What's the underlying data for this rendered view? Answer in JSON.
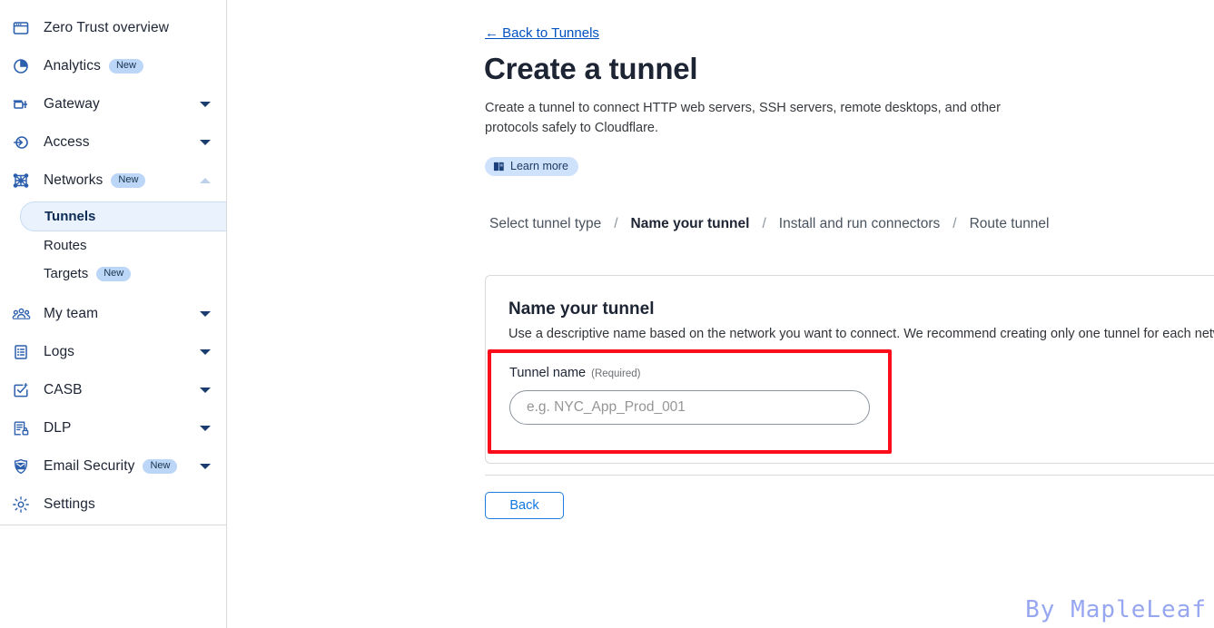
{
  "sidebar": {
    "items": [
      {
        "label": "Zero Trust overview",
        "icon": "window-overview-icon",
        "badge": null,
        "chevron": null
      },
      {
        "label": "Analytics",
        "icon": "pie-chart-icon",
        "badge": "New",
        "chevron": null
      },
      {
        "label": "Gateway",
        "icon": "gateway-arrow-icon",
        "badge": null,
        "chevron": "down"
      },
      {
        "label": "Access",
        "icon": "access-login-icon",
        "badge": null,
        "chevron": "down"
      },
      {
        "label": "Networks",
        "icon": "network-nodes-icon",
        "badge": "New",
        "chevron": "up"
      }
    ],
    "networks_subitems": [
      {
        "label": "Tunnels",
        "active": true,
        "badge": null
      },
      {
        "label": "Routes",
        "active": false,
        "badge": null
      },
      {
        "label": "Targets",
        "active": false,
        "badge": "New"
      }
    ],
    "items_lower": [
      {
        "label": "My team",
        "icon": "people-group-icon",
        "badge": null,
        "chevron": "down"
      },
      {
        "label": "Logs",
        "icon": "document-list-icon",
        "badge": null,
        "chevron": "down"
      },
      {
        "label": "CASB",
        "icon": "checkmark-box-icon",
        "badge": null,
        "chevron": "down"
      },
      {
        "label": "DLP",
        "icon": "document-lock-icon",
        "badge": null,
        "chevron": "down"
      },
      {
        "label": "Email Security",
        "icon": "email-shield-icon",
        "badge": "New",
        "chevron": "down"
      },
      {
        "label": "Settings",
        "icon": "gear-icon",
        "badge": null,
        "chevron": null
      }
    ]
  },
  "main": {
    "back_link": "← Back to Tunnels",
    "title": "Create a tunnel",
    "description": "Create a tunnel to connect HTTP web servers, SSH servers, remote desktops, and other protocols safely to Cloudflare.",
    "learn_more": "Learn more",
    "steps": [
      {
        "label": "Select tunnel type",
        "current": false
      },
      {
        "label": "Name your tunnel",
        "current": true
      },
      {
        "label": "Install and run connectors",
        "current": false
      },
      {
        "label": "Route tunnel",
        "current": false
      }
    ],
    "step_separator": "/",
    "card": {
      "title": "Name your tunnel",
      "subtitle": "Use a descriptive name based on the network you want to connect. We recommend creating only one tunnel for each network.",
      "field_label": "Tunnel name",
      "field_required": "(Required)",
      "field_value": "",
      "field_placeholder": "e.g. NYC_App_Prod_001"
    },
    "back_button": "Back"
  },
  "watermark": "By MapleLeaf",
  "colors": {
    "accent_blue": "#0051c3",
    "icon_blue": "#2c5fad",
    "badge_bg": "#bcd6f7",
    "active_bg": "#eaf2fd",
    "annotation_red": "#fc0d1c",
    "watermark": "#97a6f0"
  }
}
